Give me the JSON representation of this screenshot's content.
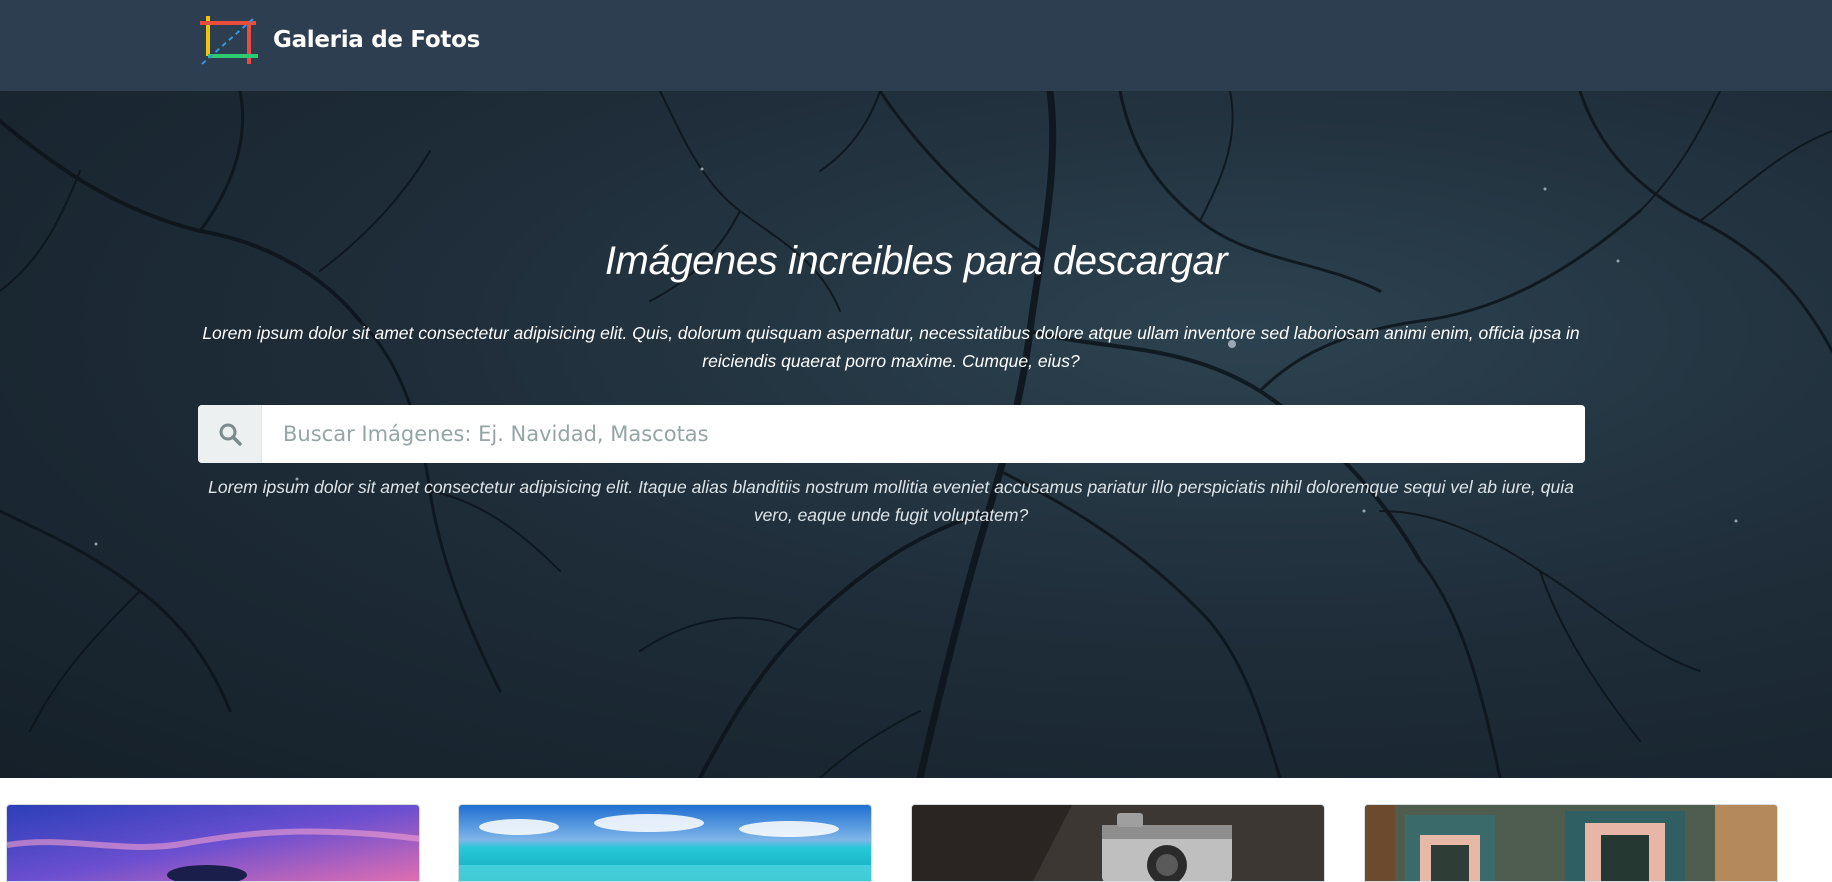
{
  "navbar": {
    "brand": "Galeria de Fotos",
    "logo_icon": "crop-frame-logo"
  },
  "hero": {
    "title": "Imágenes increibles para descargar",
    "lead": "Lorem ipsum dolor sit amet consectetur adipisicing elit. Quis, dolorum quisquam aspernatur, necessitatibus dolore atque ullam inventore sed laboriosam animi enim, officia ipsa in reiciendis quaerat porro maxime. Cumque, eius?",
    "search": {
      "placeholder": "Buscar Imágenes: Ej. Navidad, Mascotas",
      "value": "",
      "icon": "search-icon"
    },
    "help": "Lorem ipsum dolor sit amet consectetur adipisicing elit. Itaque alias blanditiis nostrum mollitia eveniet accusamus pariatur illo perspiciatis nihil doloremque sequi vel ab iure, quia vero, eaque unde fugit voluptatem?"
  },
  "gallery": {
    "cards": [
      {
        "name": "sunset-sea-photo"
      },
      {
        "name": "tropical-beach-photo"
      },
      {
        "name": "vintage-camera-photo"
      },
      {
        "name": "colorful-house-photo"
      }
    ]
  },
  "colors": {
    "navbar": "#2c3e50",
    "addon": "#ecf0f1",
    "placeholder": "#95a5a6",
    "logo_red": "#e74c3c",
    "logo_green": "#2ecc71",
    "logo_yellow": "#f1c40f",
    "logo_blue": "#3498db"
  }
}
